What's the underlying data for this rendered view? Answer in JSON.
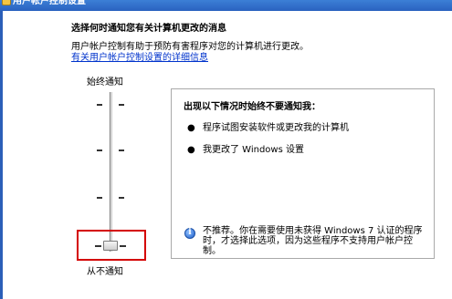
{
  "window": {
    "title": "用户帐户控制设置"
  },
  "heading": "选择何时通知您有关计算机更改的消息",
  "description": "用户帐户控制有助于预防有害程序对您的计算机进行更改。",
  "link_text": "有关用户帐户控制设置的详细信息",
  "slider": {
    "top_label": "始终通知",
    "bottom_label": "从不通知",
    "levels": 4,
    "current_level": 1,
    "current_level_name": "从不通知"
  },
  "info": {
    "title": "出现以下情况时始终不要通知我：",
    "bullets": [
      "程序试图安装软件或更改我的计算机",
      "我更改了 Windows 设置"
    ],
    "note": "不推荐。你在需要使用未获得 Windows 7 认证的程序时，才选择此选项，因为这些程序不支持用户帐户控制。"
  },
  "colors": {
    "titlebar": "#2a62bf",
    "link": "#0033cc",
    "highlight": "#d40000"
  },
  "icons": {
    "window": "shield-icon",
    "info": "info-icon"
  }
}
